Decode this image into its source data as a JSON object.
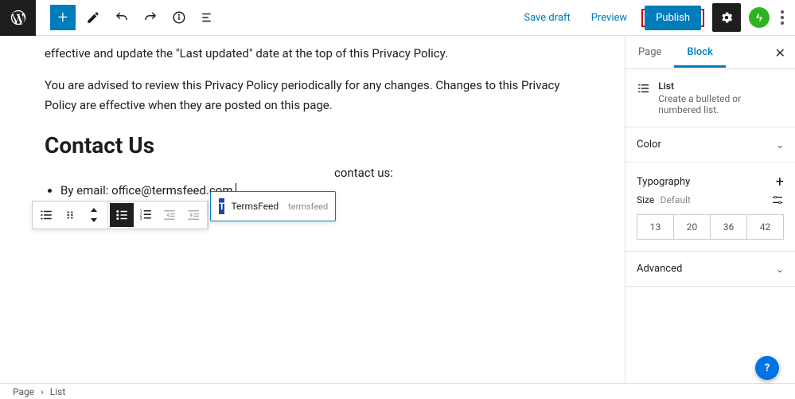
{
  "topbar": {
    "save_draft": "Save draft",
    "preview": "Preview",
    "publish": "Publish"
  },
  "content": {
    "para1_fragment": "effective and update the \"Last updated\" date at the top of this Privacy Policy.",
    "para2": "You are advised to review this Privacy Policy periodically for any changes. Changes to this Privacy Policy are effective when they are posted on this page.",
    "heading": "Contact Us",
    "hidden_line_tail": "contact us:",
    "list_item": "By email: office@termsfeed.com"
  },
  "link_popover": {
    "favicon_letter": "T",
    "title": "TermsFeed",
    "sub": "termsfeed"
  },
  "sidebar": {
    "tabs": {
      "page": "Page",
      "block": "Block"
    },
    "list": {
      "title": "List",
      "desc": "Create a bulleted or numbered list."
    },
    "panels": {
      "color": "Color",
      "typography": "Typography",
      "size_label": "Size",
      "size_default": "Default",
      "sizes": [
        "13",
        "20",
        "36",
        "42"
      ],
      "advanced": "Advanced"
    }
  },
  "breadcrumb": {
    "root": "Page",
    "current": "List"
  },
  "help": "?"
}
